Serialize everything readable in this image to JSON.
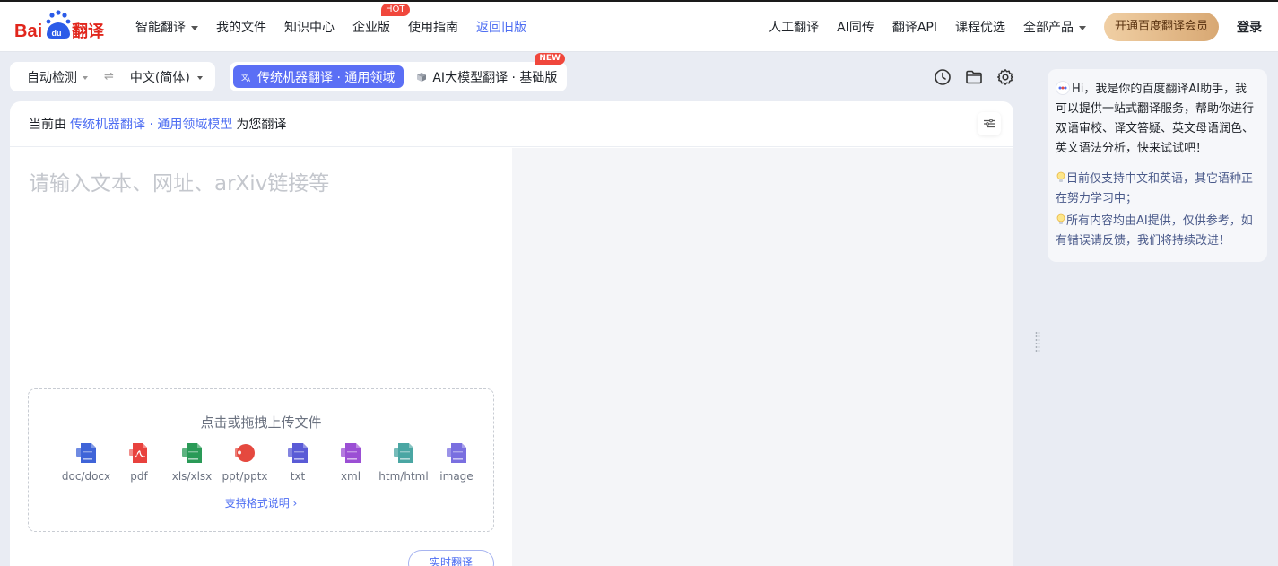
{
  "header": {
    "logo": "Bai du 翻译",
    "nav_left": [
      {
        "label": "智能翻译",
        "dropdown": true
      },
      {
        "label": "我的文件"
      },
      {
        "label": "知识中心"
      },
      {
        "label": "企业版",
        "badge": "HOT"
      },
      {
        "label": "使用指南"
      },
      {
        "label": "返回旧版",
        "active": true
      }
    ],
    "nav_right": [
      {
        "label": "人工翻译"
      },
      {
        "label": "AI同传"
      },
      {
        "label": "翻译API"
      },
      {
        "label": "课程优选"
      },
      {
        "label": "全部产品",
        "dropdown": true
      }
    ],
    "vip_label": "开通百度翻译会员",
    "login_label": "登录"
  },
  "lang": {
    "source": "自动检测",
    "swap": "⇌",
    "target": "中文(简体)"
  },
  "mode": {
    "active_label": "传统机器翻译 · 通用领域",
    "inactive_label": "AI大模型翻译 · 基础版",
    "new_badge": "NEW"
  },
  "editor": {
    "head_prefix": "当前由",
    "head_model": "传统机器翻译 · 通用领域模型",
    "head_suffix": "为您翻译",
    "placeholder": "请输入文本、网址、arXiv链接等"
  },
  "upload": {
    "title": "点击或拖拽上传文件",
    "types": [
      {
        "label": "doc/docx",
        "icon": "word-icon",
        "color": "#3f64d8"
      },
      {
        "label": "pdf",
        "icon": "pdf-icon",
        "color": "#e8423e"
      },
      {
        "label": "xls/xlsx",
        "icon": "excel-icon",
        "color": "#2a9a57"
      },
      {
        "label": "ppt/pptx",
        "icon": "ppt-icon",
        "color": "#e5493f"
      },
      {
        "label": "txt",
        "icon": "txt-icon",
        "color": "#5a5bd6"
      },
      {
        "label": "xml",
        "icon": "xml-icon",
        "color": "#9b4fd4"
      },
      {
        "label": "htm/html",
        "icon": "html-icon",
        "color": "#4aa6a3"
      },
      {
        "label": "image",
        "icon": "image-icon",
        "color": "#7a6fe0"
      }
    ],
    "format_link": "支持格式说明 ›"
  },
  "realtime_label": "实时翻译",
  "assistant": {
    "greeting": "Hi，我是你的百度翻译AI助手，我可以提供一站式翻译服务，帮助你进行双语审校、译文答疑、英文母语润色、英文语法分析，快来试试吧！",
    "tips": [
      "目前仅支持中文和英语，其它语种正在努力学习中；",
      "所有内容均由AI提供，仅供参考，如有错误请反馈，我们将持续改进！"
    ]
  }
}
